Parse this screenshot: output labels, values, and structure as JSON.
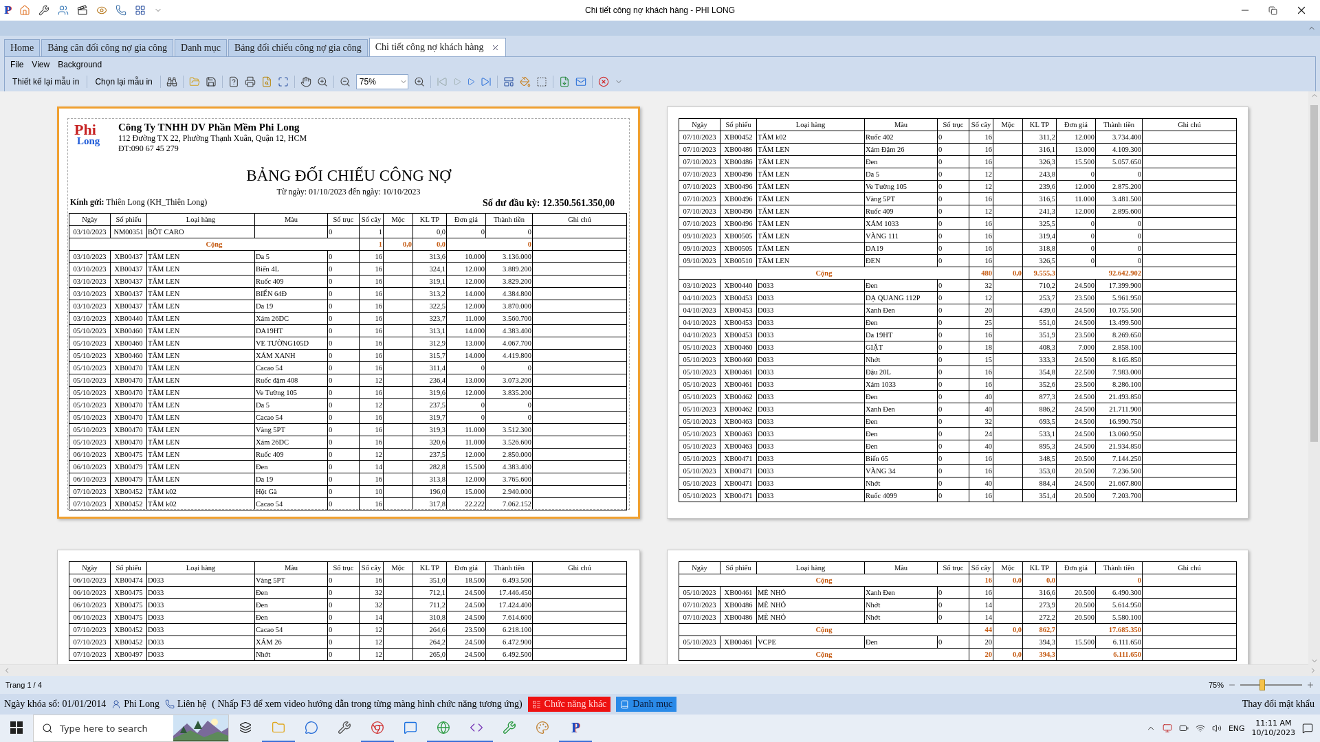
{
  "window": {
    "logo": "P",
    "title": "Chi tiết công nợ khách hàng - PHI LONG"
  },
  "tabs": [
    {
      "label": "Home",
      "selected": false
    },
    {
      "label": "Bảng cân đối công nợ gia công",
      "selected": false
    },
    {
      "label": "Danh mục",
      "selected": false
    },
    {
      "label": "Bảng đối chiếu công nợ gia công",
      "selected": false
    },
    {
      "label": "Chi tiết công nợ khách hàng",
      "selected": true,
      "closable": true
    }
  ],
  "menu": [
    "File",
    "View",
    "Background"
  ],
  "toolbar": {
    "buttons": [
      "Thiết kế lại mẫu in",
      "Chọn lại mẫu in"
    ],
    "zoom_value": "75%"
  },
  "pages": [
    {
      "selected": true,
      "header": {
        "logo_top": "Phi",
        "logo_bottom": "Long",
        "company": "Công Ty TNHH DV Phần Mềm Phi Long",
        "address": "112 Đường TX 22, Phường Thạnh Xuân, Quận 12, HCM",
        "phone": "ĐT:090 67 45 279",
        "title": "BẢNG ĐỐI CHIẾU CÔNG NỢ",
        "date_range": "Từ ngày: 01/10/2023 đến ngày: 10/10/2023",
        "recipient": "**Kính gửi:** Thiên Long (KH_Thiên Long)",
        "opening_balance": "Số dư đầu kỳ: 12.350.561.350,00"
      },
      "columns": [
        "Ngày",
        "Số phiếu",
        "Loại hàng",
        "Màu",
        "Số trục",
        "Số cây",
        "Mộc",
        "KL TP",
        "Đơn giá",
        "Thành tiền",
        "Ghi chú"
      ],
      "rows": [
        {
          "kind": "item",
          "ngay": "03/10/2023",
          "phieu": "NM00351",
          "loai": "BỘT CARO",
          "truc": "0",
          "cay": "1",
          "kl": "0,0",
          "gia": "0",
          "tien": "0"
        },
        {
          "kind": "total",
          "label": "Cộng",
          "cay": "1",
          "moc": "0,0",
          "kl": "0,0",
          "tien": "0"
        },
        {
          "kind": "item",
          "ngay": "03/10/2023",
          "phieu": "XB00437",
          "loai": "TĂM LEN",
          "mau": "Da 5",
          "truc": "0",
          "cay": "16",
          "kl": "313,6",
          "gia": "10.000",
          "tien": "3.136.000"
        },
        {
          "kind": "item",
          "ngay": "03/10/2023",
          "phieu": "XB00437",
          "loai": "TĂM LEN",
          "mau": "Biển 4L",
          "truc": "0",
          "cay": "16",
          "kl": "324,1",
          "gia": "12.000",
          "tien": "3.889.200"
        },
        {
          "kind": "item",
          "ngay": "03/10/2023",
          "phieu": "XB00437",
          "loai": "TĂM LEN",
          "mau": "Ruốc 409",
          "truc": "0",
          "cay": "16",
          "kl": "319,1",
          "gia": "12.000",
          "tien": "3.829.200"
        },
        {
          "kind": "item",
          "ngay": "03/10/2023",
          "phieu": "XB00437",
          "loai": "TĂM LEN",
          "mau": "BIỂN 64Đ",
          "truc": "0",
          "cay": "16",
          "kl": "313,2",
          "gia": "14.000",
          "tien": "4.384.800"
        },
        {
          "kind": "item",
          "ngay": "03/10/2023",
          "phieu": "XB00437",
          "loai": "TĂM LEN",
          "mau": "Da 19",
          "truc": "0",
          "cay": "16",
          "kl": "322,5",
          "gia": "12.000",
          "tien": "3.870.000"
        },
        {
          "kind": "item",
          "ngay": "03/10/2023",
          "phieu": "XB00440",
          "loai": "TĂM LEN",
          "mau": "Xám 26DC",
          "truc": "0",
          "cay": "16",
          "kl": "323,7",
          "gia": "11.000",
          "tien": "3.560.700"
        },
        {
          "kind": "item",
          "ngay": "05/10/2023",
          "phieu": "XB00460",
          "loai": "TĂM LEN",
          "mau": "DA19HT",
          "truc": "0",
          "cay": "16",
          "kl": "313,1",
          "gia": "14.000",
          "tien": "4.383.400"
        },
        {
          "kind": "item",
          "ngay": "05/10/2023",
          "phieu": "XB00460",
          "loai": "TĂM LEN",
          "mau": "VE TƯỜNG105D",
          "truc": "0",
          "cay": "16",
          "kl": "312,9",
          "gia": "13.000",
          "tien": "4.067.700"
        },
        {
          "kind": "item",
          "ngay": "05/10/2023",
          "phieu": "XB00460",
          "loai": "TĂM LEN",
          "mau": "XÁM XANH",
          "truc": "0",
          "cay": "16",
          "kl": "315,7",
          "gia": "14.000",
          "tien": "4.419.800"
        },
        {
          "kind": "item",
          "ngay": "05/10/2023",
          "phieu": "XB00470",
          "loai": "TĂM LEN",
          "mau": "Cacao 54",
          "truc": "0",
          "cay": "16",
          "kl": "311,4",
          "gia": "0",
          "tien": "0"
        },
        {
          "kind": "item",
          "ngay": "05/10/2023",
          "phieu": "XB00470",
          "loai": "TĂM LEN",
          "mau": "Ruốc đậm 408",
          "truc": "0",
          "cay": "12",
          "kl": "236,4",
          "gia": "13.000",
          "tien": "3.073.200"
        },
        {
          "kind": "item",
          "ngay": "05/10/2023",
          "phieu": "XB00470",
          "loai": "TĂM LEN",
          "mau": "Ve Tường 105",
          "truc": "0",
          "cay": "16",
          "kl": "319,6",
          "gia": "12.000",
          "tien": "3.835.200"
        },
        {
          "kind": "item",
          "ngay": "05/10/2023",
          "phieu": "XB00470",
          "loai": "TĂM LEN",
          "mau": "Da 5",
          "truc": "0",
          "cay": "12",
          "kl": "237,5",
          "gia": "0",
          "tien": "0"
        },
        {
          "kind": "item",
          "ngay": "05/10/2023",
          "phieu": "XB00470",
          "loai": "TĂM LEN",
          "mau": "Cacao 54",
          "truc": "0",
          "cay": "16",
          "kl": "319,7",
          "gia": "0",
          "tien": "0"
        },
        {
          "kind": "item",
          "ngay": "05/10/2023",
          "phieu": "XB00470",
          "loai": "TĂM LEN",
          "mau": "Vàng 5PT",
          "truc": "0",
          "cay": "16",
          "kl": "319,3",
          "gia": "11.000",
          "tien": "3.512.300"
        },
        {
          "kind": "item",
          "ngay": "05/10/2023",
          "phieu": "XB00470",
          "loai": "TĂM LEN",
          "mau": "Xám 26DC",
          "truc": "0",
          "cay": "16",
          "kl": "320,6",
          "gia": "11.000",
          "tien": "3.526.600"
        },
        {
          "kind": "item",
          "ngay": "06/10/2023",
          "phieu": "XB00475",
          "loai": "TĂM LEN",
          "mau": "Ruốc 409",
          "truc": "0",
          "cay": "12",
          "kl": "237,5",
          "gia": "12.000",
          "tien": "2.850.000"
        },
        {
          "kind": "item",
          "ngay": "06/10/2023",
          "phieu": "XB00479",
          "loai": "TĂM LEN",
          "mau": "Đen",
          "truc": "0",
          "cay": "14",
          "kl": "282,8",
          "gia": "15.500",
          "tien": "4.383.400"
        },
        {
          "kind": "item",
          "ngay": "06/10/2023",
          "phieu": "XB00479",
          "loai": "TĂM LEN",
          "mau": "Da 19",
          "truc": "0",
          "cay": "16",
          "kl": "313,8",
          "gia": "12.000",
          "tien": "3.765.600"
        },
        {
          "kind": "item",
          "ngay": "07/10/2023",
          "phieu": "XB00452",
          "loai": "TĂM k02",
          "mau": "Hột Gà",
          "truc": "0",
          "cay": "10",
          "kl": "196,0",
          "gia": "15.000",
          "tien": "2.940.000"
        },
        {
          "kind": "item",
          "ngay": "07/10/2023",
          "phieu": "XB00452",
          "loai": "TĂM k02",
          "mau": "Cacao 54",
          "truc": "0",
          "cay": "16",
          "kl": "317,8",
          "gia": "22.222",
          "tien": "7.062.152"
        }
      ]
    },
    {
      "selected": false,
      "columns": [
        "Ngày",
        "Số phiếu",
        "Loại hàng",
        "Màu",
        "Số trục",
        "Số cây",
        "Mộc",
        "KL TP",
        "Đơn giá",
        "Thành tiền",
        "Ghi chú"
      ],
      "rows": [
        {
          "kind": "item",
          "ngay": "07/10/2023",
          "phieu": "XB00452",
          "loai": "TĂM k02",
          "mau": "Ruốc 402",
          "truc": "0",
          "cay": "16",
          "kl": "311,2",
          "gia": "12.000",
          "tien": "3.734.400"
        },
        {
          "kind": "item",
          "ngay": "07/10/2023",
          "phieu": "XB00486",
          "loai": "TĂM LEN",
          "mau": "Xám Đậm 26",
          "truc": "0",
          "cay": "16",
          "kl": "316,1",
          "gia": "13.000",
          "tien": "4.109.300"
        },
        {
          "kind": "item",
          "ngay": "07/10/2023",
          "phieu": "XB00486",
          "loai": "TĂM LEN",
          "mau": "Đen",
          "truc": "0",
          "cay": "16",
          "kl": "326,3",
          "gia": "15.500",
          "tien": "5.057.650"
        },
        {
          "kind": "item",
          "ngay": "07/10/2023",
          "phieu": "XB00496",
          "loai": "TĂM LEN",
          "mau": "Da 5",
          "truc": "0",
          "cay": "12",
          "kl": "243,8",
          "gia": "0",
          "tien": "0"
        },
        {
          "kind": "item",
          "ngay": "07/10/2023",
          "phieu": "XB00496",
          "loai": "TĂM LEN",
          "mau": "Ve Tường 105",
          "truc": "0",
          "cay": "12",
          "kl": "239,6",
          "gia": "12.000",
          "tien": "2.875.200"
        },
        {
          "kind": "item",
          "ngay": "07/10/2023",
          "phieu": "XB00496",
          "loai": "TĂM LEN",
          "mau": "Vàng 5PT",
          "truc": "0",
          "cay": "16",
          "kl": "316,5",
          "gia": "11.000",
          "tien": "3.481.500"
        },
        {
          "kind": "item",
          "ngay": "07/10/2023",
          "phieu": "XB00496",
          "loai": "TĂM LEN",
          "mau": "Ruốc 409",
          "truc": "0",
          "cay": "12",
          "kl": "241,3",
          "gia": "12.000",
          "tien": "2.895.600"
        },
        {
          "kind": "item",
          "ngay": "07/10/2023",
          "phieu": "XB00496",
          "loai": "TĂM LEN",
          "mau": "XÁM 1033",
          "truc": "0",
          "cay": "16",
          "kl": "325,5",
          "gia": "0",
          "tien": "0"
        },
        {
          "kind": "item",
          "ngay": "09/10/2023",
          "phieu": "XB00505",
          "loai": "TĂM LEN",
          "mau": "VÀNG 111",
          "truc": "0",
          "cay": "16",
          "kl": "319,4",
          "gia": "0",
          "tien": "0"
        },
        {
          "kind": "item",
          "ngay": "09/10/2023",
          "phieu": "XB00505",
          "loai": "TĂM LEN",
          "mau": "DA19",
          "truc": "0",
          "cay": "16",
          "kl": "318,8",
          "gia": "0",
          "tien": "0"
        },
        {
          "kind": "item",
          "ngay": "09/10/2023",
          "phieu": "XB00510",
          "loai": "TĂM LEN",
          "mau": "ĐEN",
          "truc": "0",
          "cay": "16",
          "kl": "326,5",
          "gia": "0",
          "tien": "0"
        },
        {
          "kind": "total",
          "label": "Cộng",
          "cay": "480",
          "moc": "0,0",
          "kl": "9.555,3",
          "tien": "92.642.902"
        },
        {
          "kind": "item",
          "ngay": "03/10/2023",
          "phieu": "XB00440",
          "loai": "D033",
          "mau": "Đen",
          "truc": "0",
          "cay": "32",
          "kl": "710,2",
          "gia": "24.500",
          "tien": "17.399.900"
        },
        {
          "kind": "item",
          "ngay": "04/10/2023",
          "phieu": "XB00453",
          "loai": "D033",
          "mau": "DẠ QUANG 112P",
          "truc": "0",
          "cay": "12",
          "kl": "253,7",
          "gia": "23.500",
          "tien": "5.961.950"
        },
        {
          "kind": "item",
          "ngay": "04/10/2023",
          "phieu": "XB00453",
          "loai": "D033",
          "mau": "Xanh Đen",
          "truc": "0",
          "cay": "20",
          "kl": "439,0",
          "gia": "24.500",
          "tien": "10.755.500"
        },
        {
          "kind": "item",
          "ngay": "04/10/2023",
          "phieu": "XB00453",
          "loai": "D033",
          "mau": "Đen",
          "truc": "0",
          "cay": "25",
          "kl": "551,0",
          "gia": "24.500",
          "tien": "13.499.500"
        },
        {
          "kind": "item",
          "ngay": "04/10/2023",
          "phieu": "XB00453",
          "loai": "D033",
          "mau": "Da 19HT",
          "truc": "0",
          "cay": "16",
          "kl": "351,9",
          "gia": "23.500",
          "tien": "8.269.650"
        },
        {
          "kind": "item",
          "ngay": "05/10/2023",
          "phieu": "XB00460",
          "loai": "D033",
          "mau": "GIẶT",
          "truc": "0",
          "cay": "18",
          "kl": "408,3",
          "gia": "7.000",
          "tien": "2.858.100"
        },
        {
          "kind": "item",
          "ngay": "05/10/2023",
          "phieu": "XB00460",
          "loai": "D033",
          "mau": "Nhớt",
          "truc": "0",
          "cay": "15",
          "kl": "333,3",
          "gia": "24.500",
          "tien": "8.165.850"
        },
        {
          "kind": "item",
          "ngay": "05/10/2023",
          "phieu": "XB00461",
          "loai": "D033",
          "mau": "Đậu 20L",
          "truc": "0",
          "cay": "16",
          "kl": "354,8",
          "gia": "22.500",
          "tien": "7.983.000"
        },
        {
          "kind": "item",
          "ngay": "05/10/2023",
          "phieu": "XB00461",
          "loai": "D033",
          "mau": "Xám 1033",
          "truc": "0",
          "cay": "16",
          "kl": "352,6",
          "gia": "23.500",
          "tien": "8.286.100"
        },
        {
          "kind": "item",
          "ngay": "05/10/2023",
          "phieu": "XB00462",
          "loai": "D033",
          "mau": "Đen",
          "truc": "0",
          "cay": "40",
          "kl": "877,3",
          "gia": "24.500",
          "tien": "21.493.850"
        },
        {
          "kind": "item",
          "ngay": "05/10/2023",
          "phieu": "XB00462",
          "loai": "D033",
          "mau": "Xanh Đen",
          "truc": "0",
          "cay": "40",
          "kl": "886,2",
          "gia": "24.500",
          "tien": "21.711.900"
        },
        {
          "kind": "item",
          "ngay": "05/10/2023",
          "phieu": "XB00463",
          "loai": "D033",
          "mau": "Đen",
          "truc": "0",
          "cay": "32",
          "kl": "693,5",
          "gia": "24.500",
          "tien": "16.990.750"
        },
        {
          "kind": "item",
          "ngay": "05/10/2023",
          "phieu": "XB00463",
          "loai": "D033",
          "mau": "Đen",
          "truc": "0",
          "cay": "24",
          "kl": "533,1",
          "gia": "24.500",
          "tien": "13.060.950"
        },
        {
          "kind": "item",
          "ngay": "05/10/2023",
          "phieu": "XB00463",
          "loai": "D033",
          "mau": "Đen",
          "truc": "0",
          "cay": "40",
          "kl": "895,3",
          "gia": "24.500",
          "tien": "21.934.850"
        },
        {
          "kind": "item",
          "ngay": "05/10/2023",
          "phieu": "XB00471",
          "loai": "D033",
          "mau": "Biển 65",
          "truc": "0",
          "cay": "16",
          "kl": "348,5",
          "gia": "20.500",
          "tien": "7.144.250"
        },
        {
          "kind": "item",
          "ngay": "05/10/2023",
          "phieu": "XB00471",
          "loai": "D033",
          "mau": "VÀNG 34",
          "truc": "0",
          "cay": "16",
          "kl": "353,0",
          "gia": "20.500",
          "tien": "7.236.500"
        },
        {
          "kind": "item",
          "ngay": "05/10/2023",
          "phieu": "XB00471",
          "loai": "D033",
          "mau": "Nhớt",
          "truc": "0",
          "cay": "40",
          "kl": "884,4",
          "gia": "24.500",
          "tien": "21.667.800"
        },
        {
          "kind": "item",
          "ngay": "05/10/2023",
          "phieu": "XB00471",
          "loai": "D033",
          "mau": "Ruốc 4099",
          "truc": "0",
          "cay": "16",
          "kl": "351,4",
          "gia": "20.500",
          "tien": "7.203.700"
        }
      ]
    },
    {
      "selected": false,
      "columns": [
        "Ngày",
        "Số phiếu",
        "Loại hàng",
        "Màu",
        "Số trục",
        "Số cây",
        "Mộc",
        "KL TP",
        "Đơn giá",
        "Thành tiền",
        "Ghi chú"
      ],
      "rows": [
        {
          "kind": "item",
          "ngay": "06/10/2023",
          "phieu": "XB00474",
          "loai": "D033",
          "mau": "Vàng 5PT",
          "truc": "0",
          "cay": "16",
          "kl": "351,0",
          "gia": "18.500",
          "tien": "6.493.500"
        },
        {
          "kind": "item",
          "ngay": "06/10/2023",
          "phieu": "XB00475",
          "loai": "D033",
          "mau": "Đen",
          "truc": "0",
          "cay": "32",
          "kl": "712,1",
          "gia": "24.500",
          "tien": "17.446.450"
        },
        {
          "kind": "item",
          "ngay": "06/10/2023",
          "phieu": "XB00475",
          "loai": "D033",
          "mau": "Đen",
          "truc": "0",
          "cay": "32",
          "kl": "711,2",
          "gia": "24.500",
          "tien": "17.424.400"
        },
        {
          "kind": "item",
          "ngay": "06/10/2023",
          "phieu": "XB00475",
          "loai": "D033",
          "mau": "Đen",
          "truc": "0",
          "cay": "14",
          "kl": "310,8",
          "gia": "24.500",
          "tien": "7.614.600"
        },
        {
          "kind": "item",
          "ngay": "07/10/2023",
          "phieu": "XB00452",
          "loai": "D033",
          "mau": "Cacao 54",
          "truc": "0",
          "cay": "12",
          "kl": "264,6",
          "gia": "23.500",
          "tien": "6.218.100"
        },
        {
          "kind": "item",
          "ngay": "07/10/2023",
          "phieu": "XB00452",
          "loai": "D033",
          "mau": "XÁM 26",
          "truc": "0",
          "cay": "12",
          "kl": "264,2",
          "gia": "24.500",
          "tien": "6.472.900"
        },
        {
          "kind": "item",
          "ngay": "07/10/2023",
          "phieu": "XB00497",
          "loai": "D033",
          "mau": "Nhớt",
          "truc": "0",
          "cay": "12",
          "kl": "265,0",
          "gia": "24.500",
          "tien": "6.492.500"
        }
      ]
    },
    {
      "selected": false,
      "columns": [
        "Ngày",
        "Số phiếu",
        "Loại hàng",
        "Màu",
        "Số trục",
        "Số cây",
        "Mộc",
        "KL TP",
        "Đơn giá",
        "Thành tiền",
        "Ghi chú"
      ],
      "rows": [
        {
          "kind": "total",
          "label": "Cộng",
          "cay": "16",
          "moc": "0,0",
          "kl": "0,0",
          "tien": "0"
        },
        {
          "kind": "item",
          "ngay": "05/10/2023",
          "phieu": "XB00461",
          "loai": "MÈ NHỎ",
          "mau": "Xanh Đen",
          "truc": "0",
          "cay": "16",
          "kl": "316,6",
          "gia": "20.500",
          "tien": "6.490.300"
        },
        {
          "kind": "item",
          "ngay": "07/10/2023",
          "phieu": "XB00486",
          "loai": "MÈ NHỎ",
          "mau": "Nhớt",
          "truc": "0",
          "cay": "14",
          "kl": "273,9",
          "gia": "20.500",
          "tien": "5.614.950"
        },
        {
          "kind": "item",
          "ngay": "07/10/2023",
          "phieu": "XB00486",
          "loai": "MÈ NHỎ",
          "mau": "Nhớt",
          "truc": "0",
          "cay": "14",
          "kl": "272,2",
          "gia": "20.500",
          "tien": "5.580.100"
        },
        {
          "kind": "total",
          "label": "Cộng",
          "cay": "44",
          "moc": "0,0",
          "kl": "862,7",
          "tien": "17.685.350"
        },
        {
          "kind": "item",
          "ngay": "05/10/2023",
          "phieu": "XB00461",
          "loai": "VCPE",
          "mau": "Đen",
          "truc": "0",
          "cay": "20",
          "kl": "394,3",
          "gia": "15.500",
          "tien": "6.111.650"
        },
        {
          "kind": "total",
          "label": "Cộng",
          "cay": "20",
          "moc": "0,0",
          "kl": "394,3",
          "tien": "6.111.650"
        }
      ]
    }
  ],
  "status_bar": {
    "page": "Trang 1 / 4",
    "zoom": "75%",
    "zoom_slider": {
      "level": 0.35
    }
  },
  "info_bar": {
    "lock_date": "Ngày khóa sổ: 01/01/2014",
    "user": "Phi Long",
    "contact": "Liên hệ",
    "hint": "( Nhấp F3 để xem video hướng dẫn trong từng màng hình chức năng tương ứng)",
    "other_functions": "Chức năng khác",
    "catalog": "Danh mục",
    "change_password": "Thay đổi mật khẩu"
  },
  "taskbar": {
    "search_placeholder": "Type here to search",
    "app_logo": "P",
    "language": "ENG",
    "time": "11:11 AM",
    "date": "10/10/2023"
  }
}
